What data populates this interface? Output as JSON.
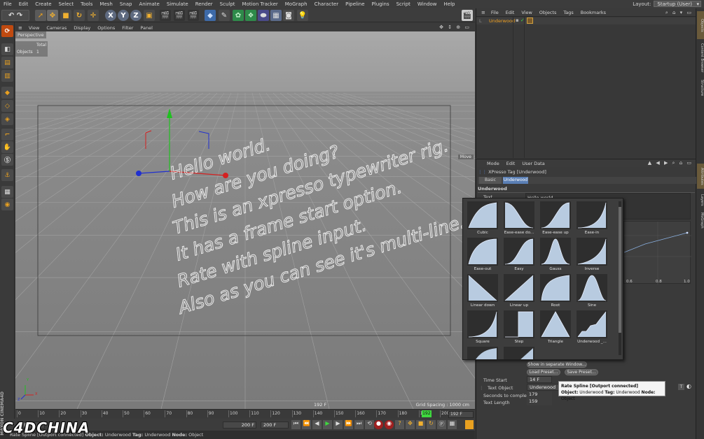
{
  "menubar": {
    "items": [
      "File",
      "Edit",
      "Create",
      "Select",
      "Tools",
      "Mesh",
      "Snap",
      "Animate",
      "Simulate",
      "Render",
      "Sculpt",
      "Motion Tracker",
      "MoGraph",
      "Character",
      "Pipeline",
      "Plugins",
      "Script",
      "Window",
      "Help"
    ],
    "layout_label": "Layout:",
    "layout_value": "Startup (User)"
  },
  "toolbar": {
    "axis_x": "X",
    "axis_y": "Y",
    "axis_z": "Z"
  },
  "viewport": {
    "menu": [
      "View",
      "Cameras",
      "Display",
      "Options",
      "Filter",
      "Panel"
    ],
    "view_name": "Perspective",
    "stats_header": "Total",
    "stats_label": "Objects",
    "stats_value": "1",
    "move_label": "Move",
    "frame_readout": "192 F",
    "grid_spacing": "Grid Spacing : 1000 cm",
    "text_lines": [
      "Hello world.",
      "How are you doing?",
      "This is an xpresso typewriter rig.",
      "It has a frame start option.",
      "Rate with spline input.",
      "Also as you can see it's multi-line."
    ],
    "axis_y_label": "Y",
    "axis_x_label": "X",
    "axis_z_label": "Z"
  },
  "timeline": {
    "ticks": [
      "0",
      "10",
      "20",
      "30",
      "40",
      "50",
      "60",
      "70",
      "80",
      "90",
      "100",
      "110",
      "120",
      "130",
      "140",
      "150",
      "160",
      "170",
      "180",
      "190",
      "200"
    ],
    "current_frame": "192",
    "end_field": "192 F",
    "playhead_value": 192
  },
  "transport": {
    "start_field": "0 F",
    "min_field": "200 F",
    "max_field": "200 F"
  },
  "status": {
    "text": "Rate Spline [Outport connected]",
    "object_label": "Object:",
    "object_value": "Underwood",
    "tag_label": "Tag:",
    "tag_value": "Underwood",
    "node_label": "Node:",
    "node_value": "Object"
  },
  "object_manager": {
    "menu": [
      "File",
      "Edit",
      "View",
      "Objects",
      "Tags",
      "Bookmarks"
    ],
    "object_name": "Underwood"
  },
  "right_tabs": [
    "Objects",
    "Content Browser",
    "Structure",
    "Attributes",
    "Layers",
    "MoGraph"
  ],
  "attributes": {
    "menu": [
      "Mode",
      "Edit",
      "User Data"
    ],
    "tag_title": "XPresso Tag [Underwood]",
    "tabs": [
      "Basic",
      "Underwood"
    ],
    "section": "Underwood",
    "text_label": "Text",
    "text_value": "Hello world.",
    "graph_ticks": [
      "0.6",
      "0.8",
      "1.0"
    ],
    "show_window_btn": "Show in separate Window...",
    "load_preset_btn": "Load Preset...",
    "save_preset_btn": "Save Preset...",
    "time_start_label": "Time Start",
    "time_start_value": "14 F",
    "text_object_label": "Text Object",
    "text_object_value": "Underwood",
    "seconds_label": "Seconds to complete",
    "seconds_value": "179",
    "text_length_label": "Text Length",
    "text_length_value": "159"
  },
  "spline_presets": {
    "items": [
      "Cubic",
      "Ease-ease do...",
      "Ease-ease up",
      "Ease-in",
      "Ease-out",
      "Easy",
      "Gauss",
      "Inverse",
      "Linear down",
      "Linear up",
      "Root",
      "Sine",
      "Square",
      "Step",
      "Triangle",
      "Underwood _..."
    ]
  },
  "tooltip": {
    "title": "Rate Spline [Outport connected]",
    "object_label": "Object:",
    "object_value": "Underwood",
    "tag_label": "Tag:",
    "tag_value": "Underwood",
    "node_label": "Node:",
    "node_value": "Object"
  },
  "watermark": "C4DCHINA",
  "side_brand": "MAXON CINEMA4D",
  "colors": {
    "accent_orange": "#f0a020",
    "active_tab": "#5a7fb5",
    "viewport_bg": "#8a8a8a",
    "axis_x": "#d42020",
    "axis_y": "#20c020",
    "axis_z": "#2030d0",
    "playhead": "#3ed83e"
  }
}
